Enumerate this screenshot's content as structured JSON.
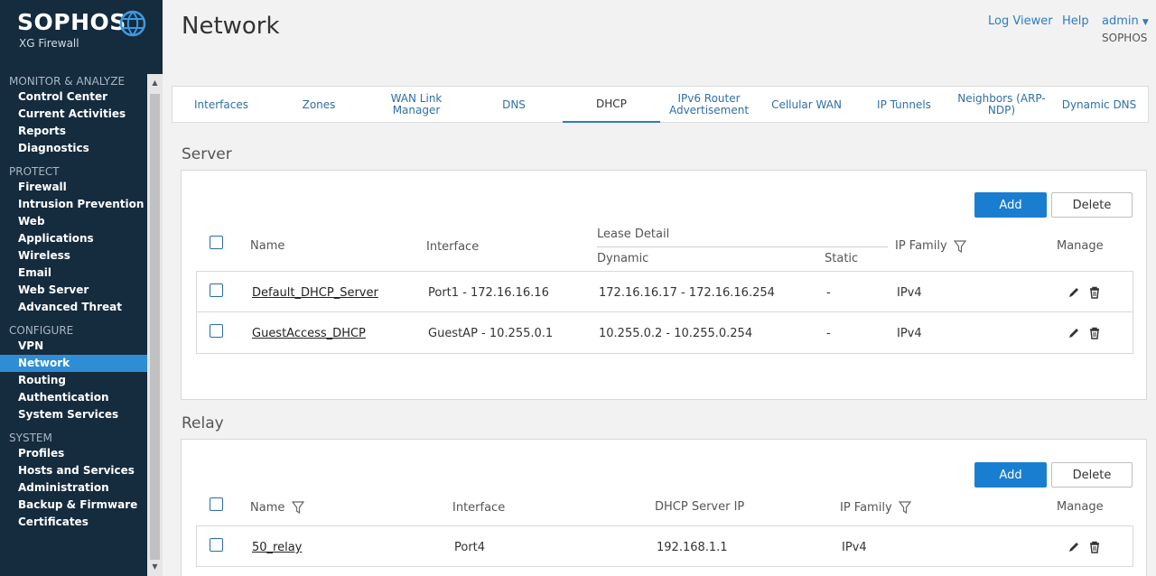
{
  "brand": {
    "name": "SOPHOS",
    "product": "XG Firewall"
  },
  "sidebar": {
    "groups": [
      {
        "heading": "MONITOR & ANALYZE",
        "items": [
          "Control Center",
          "Current Activities",
          "Reports",
          "Diagnostics"
        ]
      },
      {
        "heading": "PROTECT",
        "items": [
          "Firewall",
          "Intrusion Prevention",
          "Web",
          "Applications",
          "Wireless",
          "Email",
          "Web Server",
          "Advanced Threat"
        ]
      },
      {
        "heading": "CONFIGURE",
        "items": [
          "VPN",
          "Network",
          "Routing",
          "Authentication",
          "System Services"
        ]
      },
      {
        "heading": "SYSTEM",
        "items": [
          "Profiles",
          "Hosts and Services",
          "Administration",
          "Backup & Firmware",
          "Certificates"
        ]
      }
    ],
    "active_item": "Network"
  },
  "header": {
    "title": "Network",
    "log_viewer": "Log Viewer",
    "help": "Help",
    "user": "admin",
    "org": "SOPHOS"
  },
  "tabs": [
    {
      "label": "Interfaces"
    },
    {
      "label": "Zones"
    },
    {
      "label": "WAN Link Manager"
    },
    {
      "label": "DNS"
    },
    {
      "label": "DHCP",
      "active": true
    },
    {
      "label": "IPv6 Router Advertisement"
    },
    {
      "label": "Cellular WAN"
    },
    {
      "label": "IP Tunnels"
    },
    {
      "label": "Neighbors (ARP-NDP)"
    },
    {
      "label": "Dynamic DNS"
    }
  ],
  "server": {
    "title": "Server",
    "add_label": "Add",
    "delete_label": "Delete",
    "columns": {
      "name": "Name",
      "interface": "Interface",
      "lease_detail": "Lease Detail",
      "dynamic": "Dynamic",
      "static": "Static",
      "ip_family": "IP Family",
      "manage": "Manage"
    },
    "rows": [
      {
        "name": "Default_DHCP_Server",
        "interface": "Port1 - 172.16.16.16",
        "dynamic": "172.16.16.17 - 172.16.16.254",
        "static": "-",
        "ip_family": "IPv4"
      },
      {
        "name": "GuestAccess_DHCP",
        "interface": "GuestAP - 10.255.0.1",
        "dynamic": "10.255.0.2 - 10.255.0.254",
        "static": "-",
        "ip_family": "IPv4"
      }
    ]
  },
  "relay": {
    "title": "Relay",
    "add_label": "Add",
    "delete_label": "Delete",
    "columns": {
      "name": "Name",
      "interface": "Interface",
      "dhcp_server_ip": "DHCP Server IP",
      "ip_family": "IP Family",
      "manage": "Manage"
    },
    "rows": [
      {
        "name": "50_relay",
        "interface": "Port4",
        "dhcp_server_ip": "192.168.1.1",
        "ip_family": "IPv4"
      }
    ]
  },
  "colors": {
    "sidebar_bg": "#152b3e",
    "accent": "#2e8dd4",
    "button_blue": "#1a7ed0"
  }
}
